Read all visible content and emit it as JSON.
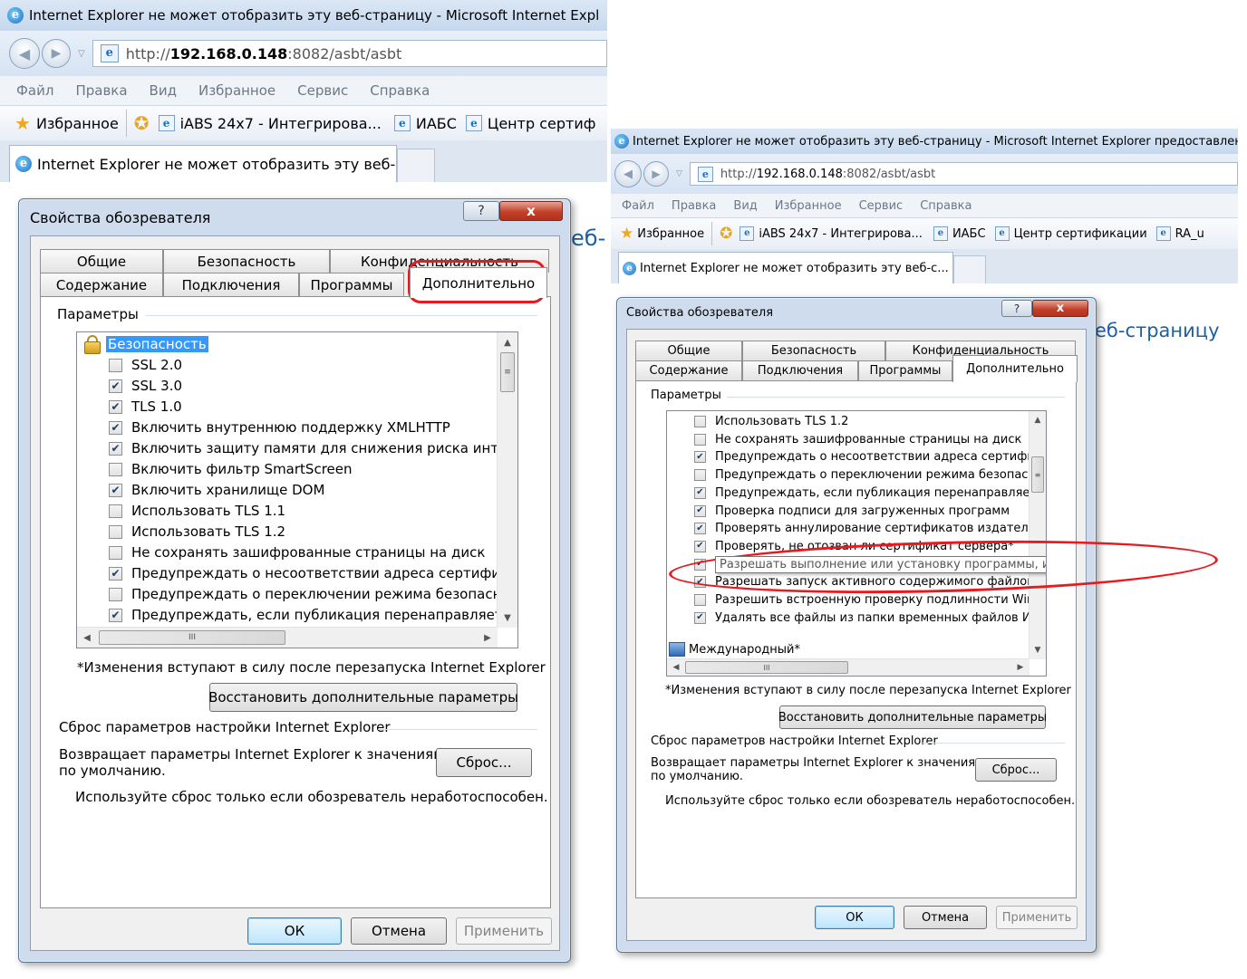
{
  "colors": {
    "accent": "#3399ff",
    "annotation": "#e8191f",
    "title_bg": "#dbe7f5"
  },
  "icons": {
    "ie": "ie-icon",
    "back": "back-icon",
    "forward": "forward-icon",
    "favorites": "star-icon",
    "lock": "lock-icon",
    "help": "help-icon",
    "close": "close-icon"
  },
  "left": {
    "window_title": "Internet Explorer не может отобразить эту веб-страницу - Microsoft Internet Expl",
    "address": {
      "scheme": "http://",
      "host": "192.168.0.148",
      "path": ":8082/asbt/asbt"
    },
    "menu": [
      "Файл",
      "Правка",
      "Вид",
      "Избранное",
      "Сервис",
      "Справка"
    ],
    "favorites_label": "Избранное",
    "favorite_links": [
      "iABS 24x7 - Интегрирова...",
      "ИАБС",
      "Центр сертиф"
    ],
    "tab_title": "Internet Explorer не может отобразить эту веб-с...",
    "page_fragment": "еб-",
    "dialog": {
      "title": "Свойства обозревателя",
      "help": "?",
      "close": "x",
      "tabs_top": [
        "Общие",
        "Безопасность",
        "Конфиденциальность"
      ],
      "tabs_bottom": [
        "Содержание",
        "Подключения",
        "Программы",
        "Дополнительно"
      ],
      "params_label": "Параметры",
      "group_security": "Безопасность",
      "items": [
        {
          "checked": false,
          "text": "SSL 2.0"
        },
        {
          "checked": true,
          "text": "SSL 3.0"
        },
        {
          "checked": true,
          "text": "TLS 1.0"
        },
        {
          "checked": true,
          "text": "Включить внутреннюю поддержку XMLHTTP"
        },
        {
          "checked": true,
          "text": "Включить защиту памяти для снижения риска интерн"
        },
        {
          "checked": false,
          "text": "Включить фильтр SmartScreen"
        },
        {
          "checked": true,
          "text": "Включить хранилище DOM"
        },
        {
          "checked": false,
          "text": "Использовать TLS 1.1"
        },
        {
          "checked": false,
          "text": "Использовать TLS 1.2"
        },
        {
          "checked": false,
          "text": "Не сохранять зашифрованные страницы на диск"
        },
        {
          "checked": true,
          "text": "Предупреждать о несоответствии адреса сертификат"
        },
        {
          "checked": false,
          "text": "Предупреждать о переключении режима безопасност"
        },
        {
          "checked": true,
          "text": "Предупреждать, если публикация перенаправляется"
        }
      ],
      "scroll_h_thumb": "III",
      "note": "*Изменения вступают в силу после перезапуска Internet Explorer",
      "restore_button": "Восстановить дополнительные параметры",
      "reset_group": "Сброс параметров настройки Internet Explorer",
      "reset_desc_1": "Возвращает параметры Internet Explorer к значениям",
      "reset_desc_2": "по умолчанию.",
      "reset_button": "Сброс...",
      "reset_hint": "Используйте сброс только если обозреватель неработоспособен.",
      "ok": "ОК",
      "cancel": "Отмена",
      "apply": "Применить"
    }
  },
  "right": {
    "window_title": "Internet Explorer не может отобразить эту веб-страницу - Microsoft Internet Explorer предоставлен",
    "address": {
      "scheme": "http://",
      "host": "192.168.0.148",
      "path": ":8082/asbt/asbt"
    },
    "menu": [
      "Файл",
      "Правка",
      "Вид",
      "Избранное",
      "Сервис",
      "Справка"
    ],
    "favorites_label": "Избранное",
    "favorite_links": [
      "iABS 24x7 - Интегрирова...",
      "ИАБС",
      "Центр сертификации",
      "RA_u"
    ],
    "tab_title": "Internet Explorer не может отобразить эту веб-с...",
    "page_fragment": "еб-страницу",
    "dialog": {
      "title": "Свойства обозревателя",
      "help": "?",
      "close": "x",
      "tabs_top": [
        "Общие",
        "Безопасность",
        "Конфиденциальность"
      ],
      "tabs_bottom": [
        "Содержание",
        "Подключения",
        "Программы",
        "Дополнительно"
      ],
      "params_label": "Параметры",
      "items": [
        {
          "checked": false,
          "text": "Использовать TLS 1.2"
        },
        {
          "checked": false,
          "text": "Не сохранять зашифрованные страницы на диск"
        },
        {
          "checked": true,
          "text": "Предупреждать о несоответствии адреса сертификат"
        },
        {
          "checked": false,
          "text": "Предупреждать о переключении режима безопасност"
        },
        {
          "checked": true,
          "text": "Предупреждать, если публикация перенаправляется"
        },
        {
          "checked": true,
          "text": "Проверка подписи для загруженных программ"
        },
        {
          "checked": true,
          "text": "Проверять аннулирование сертификатов издателей"
        },
        {
          "checked": true,
          "text": "Проверять, не отозван ли сертификат сервера*"
        },
        {
          "checked": true,
          "text": "Разрешать выполнение или установку программы, имеющую недопустимую подпись"
        },
        {
          "checked": true,
          "text": "Разрешать запуск активного содержимого файлов на"
        },
        {
          "checked": false,
          "text": "Разрешить встроенную проверку подлинности Window"
        },
        {
          "checked": true,
          "text": "Удалять все файлы из папки временных файлов Инте"
        }
      ],
      "group_international": "Международный*",
      "scroll_h_thumb": "III",
      "note": "*Изменения вступают в силу после перезапуска Internet Explorer",
      "restore_button": "Восстановить дополнительные параметры",
      "reset_group": "Сброс параметров настройки Internet Explorer",
      "reset_desc_1": "Возвращает параметры Internet Explorer к значениям",
      "reset_desc_2": "по умолчанию.",
      "reset_button": "Сброс...",
      "reset_hint": "Используйте сброс только если обозреватель неработоспособен.",
      "ok": "ОК",
      "cancel": "Отмена",
      "apply": "Применить"
    }
  }
}
